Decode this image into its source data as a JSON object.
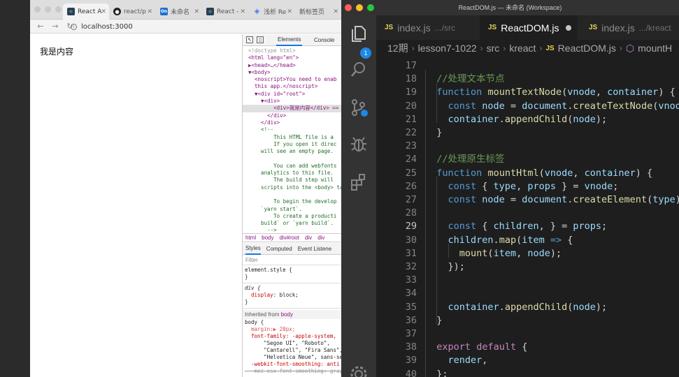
{
  "browser": {
    "tabs": [
      {
        "label": "React A",
        "icon": "react-app-icon",
        "active": true
      },
      {
        "label": "react/p",
        "icon": "github-icon"
      },
      {
        "label": "未命名",
        "icon": "on-icon"
      },
      {
        "label": "React -",
        "icon": "react-app-icon"
      },
      {
        "label": "浅析 Re",
        "icon": "blue-diamond-icon"
      },
      {
        "label": "新标签页",
        "icon": ""
      }
    ],
    "url": "localhost:3000",
    "page_text": "我是内容"
  },
  "devtools": {
    "tabs": [
      "Elements",
      "Console"
    ],
    "dom_lines": [
      "<!doctype html>",
      "<html lang=\"en\">",
      "▶<head>…</head>",
      "▼<body>",
      "  <noscript>You need to enab",
      "  this app.</noscript>",
      "  ▼<div id=\"root\">",
      "    ▼<div>",
      "        <div>我是内容</div> == $0",
      "      </div>",
      "    </div>",
      "    <!--",
      "        This HTML file is a",
      "        If you open it direc",
      "    will see an empty page.",
      "",
      "        You can add webfonts",
      "    analytics to this file.",
      "        The build step will",
      "    scripts into the <body> ta",
      "",
      "        To begin the develop",
      "    `yarn start`.",
      "        To create a producti",
      "    build` or `yarn build`.",
      "      -->"
    ],
    "breadcrumbs": [
      "html",
      "body",
      "div#root",
      "div",
      "div"
    ],
    "style_tabs": [
      "Styles",
      "Computed",
      "Event Listene"
    ],
    "filter_placeholder": "Filter",
    "element_style": "element.style {",
    "rule_close": "}",
    "div_selector": "div {",
    "div_prop": "display",
    "div_val": "block;",
    "inherited_label": "Inherited from",
    "inherited_from": "body",
    "body_selector": "body {",
    "body_lines": [
      "  margin:▶ 20px;",
      "  font-family: -apple-system,",
      "      \"Segoe UI\", \"Roboto\",",
      "      \"Cantarell\", \"Fira Sans\",",
      "      \"Helvetica Neue\", sans-se",
      "  -webkit-font-smoothing: anti",
      "  -moz-osx-font-smoothing: gray"
    ]
  },
  "vscode": {
    "title": "ReactDOM.js — 未命名 (Workspace)",
    "badge": "1",
    "tabs": [
      {
        "label": "index.js",
        "desc": ".../src",
        "active": false
      },
      {
        "label": "ReactDOM.js",
        "desc": "",
        "active": true,
        "dirty": true
      },
      {
        "label": "index.js",
        "desc": ".../kreact",
        "active": false
      }
    ],
    "breadcrumbs": [
      "12期",
      "lesson7-1022",
      "src",
      "kreact",
      "ReactDOM.js",
      "mountH"
    ],
    "current_line": "29",
    "lines": [
      {
        "n": "17",
        "t": ""
      },
      {
        "n": "18",
        "t": "  //处理文本节点"
      },
      {
        "n": "19",
        "t": "  function mountTextNode(vnode, container) {"
      },
      {
        "n": "20",
        "t": "    const node = document.createTextNode(vnode);"
      },
      {
        "n": "21",
        "t": "    container.appendChild(node);"
      },
      {
        "n": "22",
        "t": "  }"
      },
      {
        "n": "23",
        "t": ""
      },
      {
        "n": "24",
        "t": "  //处理原生标签"
      },
      {
        "n": "25",
        "t": "  function mountHtml(vnode, container) {"
      },
      {
        "n": "26",
        "t": "    const { type, props } = vnode;"
      },
      {
        "n": "27",
        "t": "    const node = document.createElement(type);"
      },
      {
        "n": "28",
        "t": ""
      },
      {
        "n": "29",
        "t": "    const { children, } = props;"
      },
      {
        "n": "30",
        "t": "    children.map(item => {"
      },
      {
        "n": "31",
        "t": "      mount(item, node);"
      },
      {
        "n": "32",
        "t": "    });"
      },
      {
        "n": "33",
        "t": ""
      },
      {
        "n": "34",
        "t": ""
      },
      {
        "n": "35",
        "t": "    container.appendChild(node);"
      },
      {
        "n": "36",
        "t": "  }"
      },
      {
        "n": "37",
        "t": ""
      },
      {
        "n": "38",
        "t": "  export default {"
      },
      {
        "n": "39",
        "t": "    render,"
      },
      {
        "n": "40",
        "t": "  };"
      }
    ]
  }
}
